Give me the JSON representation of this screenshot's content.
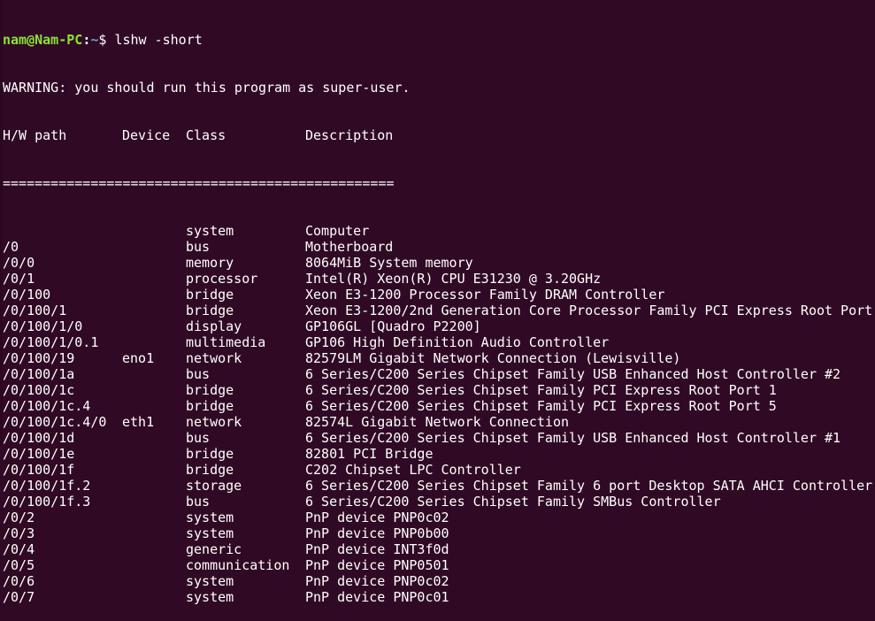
{
  "colors": {
    "background": "#300a24",
    "text": "#ffffff",
    "prompt_user": "#8ae234",
    "prompt_path": "#729fcf"
  },
  "prompt": {
    "user_host": "nam@Nam-PC",
    "separator": ":",
    "path": "~",
    "symbol": "$ ",
    "command": "lshw -short"
  },
  "warning": "WARNING: you should run this program as super-user.",
  "header": {
    "path": "H/W path",
    "device": "Device",
    "class": "Class",
    "description": "Description"
  },
  "separator_line": "=================================================",
  "rows": [
    {
      "path": "",
      "device": "",
      "class": "system",
      "description": "Computer"
    },
    {
      "path": "/0",
      "device": "",
      "class": "bus",
      "description": "Motherboard"
    },
    {
      "path": "/0/0",
      "device": "",
      "class": "memory",
      "description": "8064MiB System memory"
    },
    {
      "path": "/0/1",
      "device": "",
      "class": "processor",
      "description": "Intel(R) Xeon(R) CPU E31230 @ 3.20GHz"
    },
    {
      "path": "/0/100",
      "device": "",
      "class": "bridge",
      "description": "Xeon E3-1200 Processor Family DRAM Controller"
    },
    {
      "path": "/0/100/1",
      "device": "",
      "class": "bridge",
      "description": "Xeon E3-1200/2nd Generation Core Processor Family PCI Express Root Port"
    },
    {
      "path": "/0/100/1/0",
      "device": "",
      "class": "display",
      "description": "GP106GL [Quadro P2200]"
    },
    {
      "path": "/0/100/1/0.1",
      "device": "",
      "class": "multimedia",
      "description": "GP106 High Definition Audio Controller"
    },
    {
      "path": "/0/100/19",
      "device": "eno1",
      "class": "network",
      "description": "82579LM Gigabit Network Connection (Lewisville)"
    },
    {
      "path": "/0/100/1a",
      "device": "",
      "class": "bus",
      "description": "6 Series/C200 Series Chipset Family USB Enhanced Host Controller #2"
    },
    {
      "path": "/0/100/1c",
      "device": "",
      "class": "bridge",
      "description": "6 Series/C200 Series Chipset Family PCI Express Root Port 1"
    },
    {
      "path": "/0/100/1c.4",
      "device": "",
      "class": "bridge",
      "description": "6 Series/C200 Series Chipset Family PCI Express Root Port 5"
    },
    {
      "path": "/0/100/1c.4/0",
      "device": "eth1",
      "class": "network",
      "description": "82574L Gigabit Network Connection"
    },
    {
      "path": "/0/100/1d",
      "device": "",
      "class": "bus",
      "description": "6 Series/C200 Series Chipset Family USB Enhanced Host Controller #1"
    },
    {
      "path": "/0/100/1e",
      "device": "",
      "class": "bridge",
      "description": "82801 PCI Bridge"
    },
    {
      "path": "/0/100/1f",
      "device": "",
      "class": "bridge",
      "description": "C202 Chipset LPC Controller"
    },
    {
      "path": "/0/100/1f.2",
      "device": "",
      "class": "storage",
      "description": "6 Series/C200 Series Chipset Family 6 port Desktop SATA AHCI Controller"
    },
    {
      "path": "/0/100/1f.3",
      "device": "",
      "class": "bus",
      "description": "6 Series/C200 Series Chipset Family SMBus Controller"
    },
    {
      "path": "/0/2",
      "device": "",
      "class": "system",
      "description": "PnP device PNP0c02"
    },
    {
      "path": "/0/3",
      "device": "",
      "class": "system",
      "description": "PnP device PNP0b00"
    },
    {
      "path": "/0/4",
      "device": "",
      "class": "generic",
      "description": "PnP device INT3f0d"
    },
    {
      "path": "/0/5",
      "device": "",
      "class": "communication",
      "description": "PnP device PNP0501"
    },
    {
      "path": "/0/6",
      "device": "",
      "class": "system",
      "description": "PnP device PNP0c02"
    },
    {
      "path": "/0/7",
      "device": "",
      "class": "system",
      "description": "PnP device PNP0c01"
    }
  ]
}
